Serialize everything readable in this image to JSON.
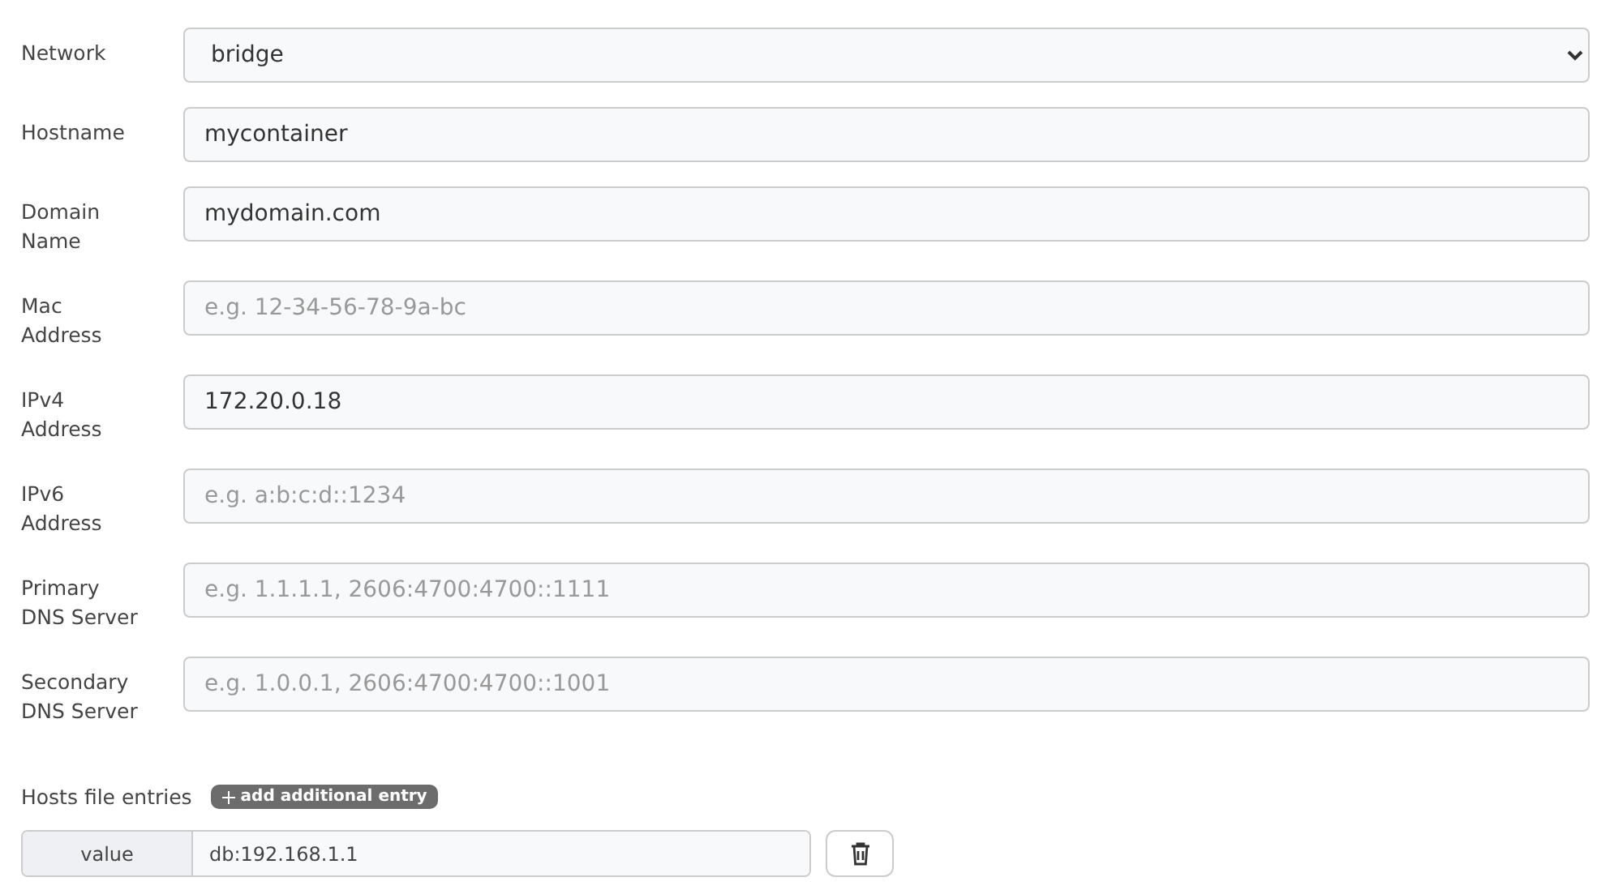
{
  "fields": [
    {
      "kind": "select",
      "label": "Network",
      "value": "bridge"
    },
    {
      "kind": "input",
      "label": "Hostname",
      "value": "mycontainer"
    },
    {
      "kind": "input",
      "label": "Domain Name",
      "value": "mydomain.com"
    },
    {
      "kind": "input",
      "label": "Mac Address",
      "placeholder": "e.g. 12-34-56-78-9a-bc"
    },
    {
      "kind": "input",
      "label": "IPv4 Address",
      "value": "172.20.0.18"
    },
    {
      "kind": "input",
      "label": "IPv6 Address",
      "placeholder": "e.g. a:b:c:d::1234"
    },
    {
      "kind": "input",
      "label": "Primary DNS Server",
      "placeholder": "e.g. 1.1.1.1, 2606:4700:4700::1111"
    },
    {
      "kind": "input",
      "label": "Secondary DNS Server",
      "placeholder": "e.g. 1.0.0.1, 2606:4700:4700::1001"
    }
  ],
  "hosts": {
    "label": "Hosts file entries",
    "add_button": "add additional entry",
    "entries": [
      {
        "key": "value",
        "value": "db:192.168.1.1"
      }
    ]
  }
}
